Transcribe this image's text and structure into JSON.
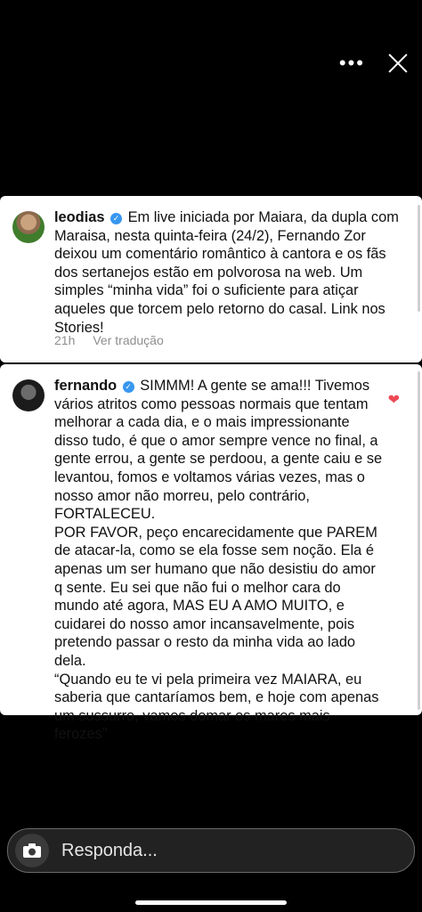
{
  "top_controls": {
    "more_icon": "more-horizontal-icon",
    "close_icon": "close-icon"
  },
  "comments": [
    {
      "username": "leodias",
      "verified": true,
      "text": "Em live iniciada por Maiara, da dupla com Maraisa, nesta quinta-feira (24/2), Fernando Zor deixou um comentário romântico à cantora e os fãs dos sertanejos estão em polvorosa na web. Um simples “minha vida” foi o suficiente para atiçar aqueles que torcem pelo retorno do casal. Link nos Stories!",
      "time": "21h",
      "translate_label": "Ver tradução"
    },
    {
      "username": "fernando",
      "verified": true,
      "text": "SIMMM! A gente se ama!!! Tivemos vários atritos como pessoas normais que tentam melhorar a cada dia, e o mais impressionante disso tudo, é que o amor sempre vence no final, a gente errou, a gente se perdoou, a gente caiu e se levantou, fomos e voltamos várias vezes, mas o nosso amor não morreu, pelo contrário, FORTALECEU.",
      "paragraph_2": "POR FAVOR, peço encarecidamente que PAREM de atacar-la, como se ela fosse sem noção. Ela é apenas um ser humano que não desistiu do amor q sente. Eu sei que não fui o melhor cara do mundo até agora, MAS EU A AMO MUITO, e cuidarei do nosso amor incansavelmente, pois pretendo passar o resto da minha vida ao lado dela.",
      "paragraph_3": "“Quando eu te vi pela primeira vez MAIARA, eu saberia que cantaríamos bem, e hoje com apenas um sussurro, vamos domar os mares mais ferozes”",
      "liked": true
    }
  ],
  "reply_bar": {
    "placeholder": "Responda...",
    "camera_icon": "camera-icon"
  }
}
